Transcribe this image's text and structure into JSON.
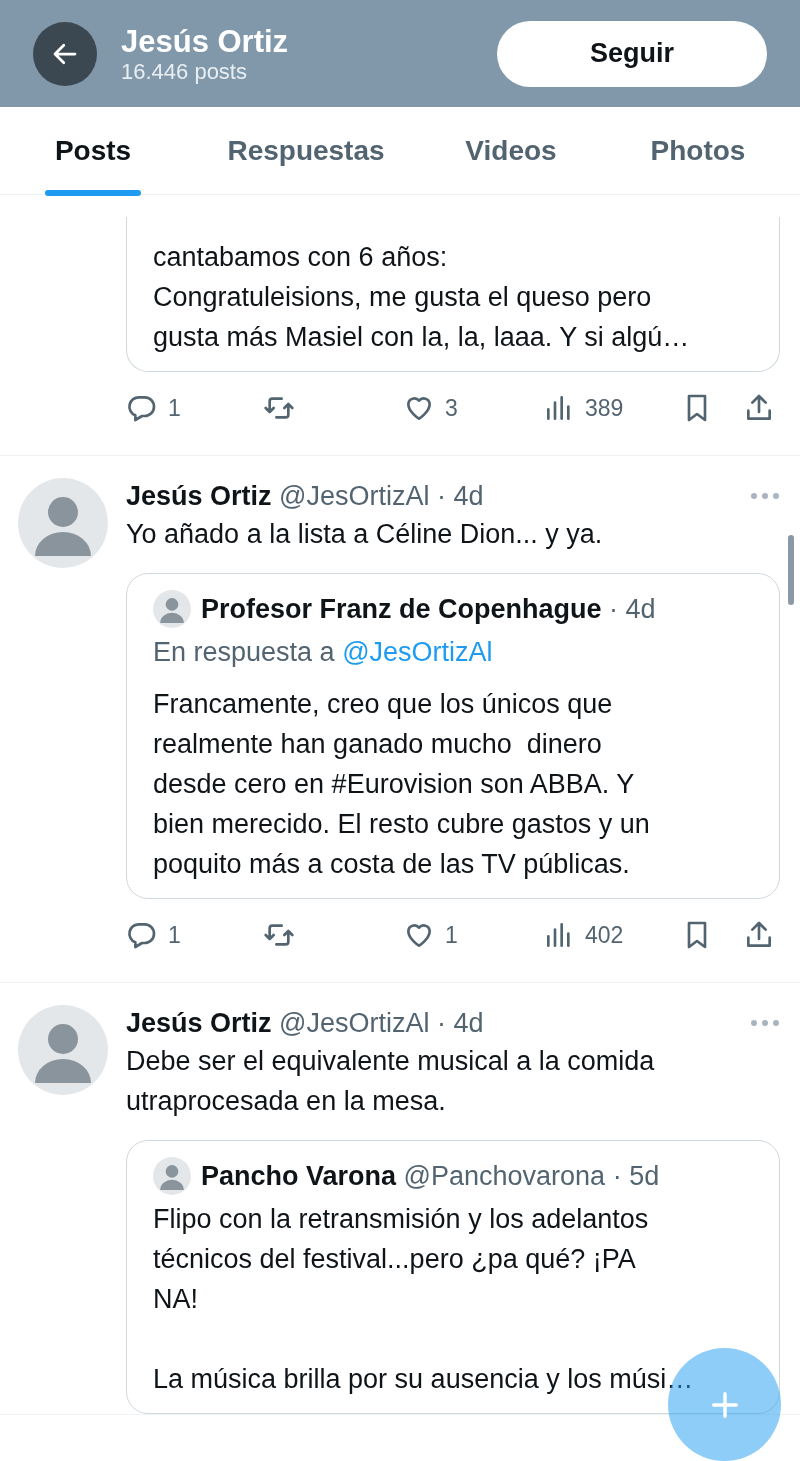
{
  "header": {
    "name": "Jesús Ortiz",
    "post_count": "16.446 posts",
    "follow_button": "Seguir"
  },
  "tabs": [
    {
      "label": "Posts",
      "selected": true
    },
    {
      "label": "Respuestas",
      "selected": false
    },
    {
      "label": "Videos",
      "selected": false
    },
    {
      "label": "Photos",
      "selected": false
    }
  ],
  "posts": [
    {
      "quote": {
        "text": "cantabamos con 6 años:\nCongratuleisions, me gusta el queso pero\ngusta más Masiel con la, la, laaa. Y si algú…"
      },
      "actions": {
        "replies": "1",
        "likes": "3",
        "views": "389"
      }
    },
    {
      "author": "Jesús Ortiz",
      "handle": "@JesOrtizAl",
      "time": "· 4d",
      "text": "Yo añado a la lista a Céline Dion... y ya.",
      "quote": {
        "author": "Profesor Franz de Copenhague",
        "time": "· 4d",
        "reply_prefix": "En respuesta a",
        "reply_to": "@JesOrtizAl",
        "text": "Francamente, creo que los únicos que\nrealmente han ganado mucho  dinero\ndesde cero en #Eurovision son ABBA. Y\nbien merecido. El resto cubre gastos y un\npoquito más a costa de las TV públicas."
      },
      "actions": {
        "replies": "1",
        "likes": "1",
        "views": "402"
      }
    },
    {
      "author": "Jesús Ortiz",
      "handle": "@JesOrtizAl",
      "time": "· 4d",
      "text": "Debe ser el equivalente musical a la comida\nutraprocesada en la mesa.",
      "quote": {
        "author": "Pancho Varona",
        "handle": "@Panchovarona",
        "time": "· 5d",
        "text": "Flipo con la retransmisión y los adelantos\ntécnicos del festival...pero ¿pa qué? ¡PA\nNA!\n\nLa música brilla por su ausencia y los músi…"
      }
    }
  ]
}
